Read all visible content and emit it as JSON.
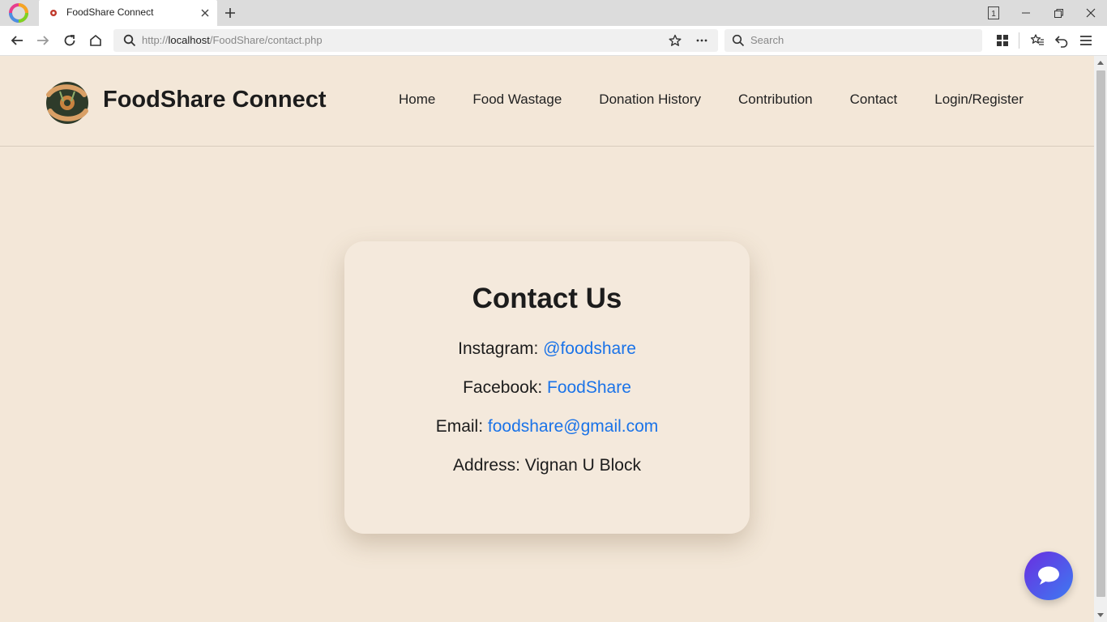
{
  "browser": {
    "tab_title": "FoodShare Connect",
    "url_prefix": "http://",
    "url_host": "localhost",
    "url_path": "/FoodShare/contact.php",
    "search_placeholder": "Search",
    "tab_count": "1"
  },
  "site": {
    "title": "FoodShare Connect",
    "nav": [
      "Home",
      "Food Wastage",
      "Donation History",
      "Contribution",
      "Contact",
      "Login/Register"
    ]
  },
  "contact": {
    "heading": "Contact Us",
    "instagram_label": "Instagram: ",
    "instagram_value": "@foodshare",
    "facebook_label": "Facebook: ",
    "facebook_value": "FoodShare",
    "email_label": "Email: ",
    "email_value": "foodshare@gmail.com",
    "address_label": "Address: ",
    "address_value": "Vignan U Block"
  },
  "colors": {
    "page_bg": "#f3e7d8",
    "link": "#1a73e8",
    "chat_gradient_start": "#6a2ee0",
    "chat_gradient_end": "#3d7bf2"
  }
}
